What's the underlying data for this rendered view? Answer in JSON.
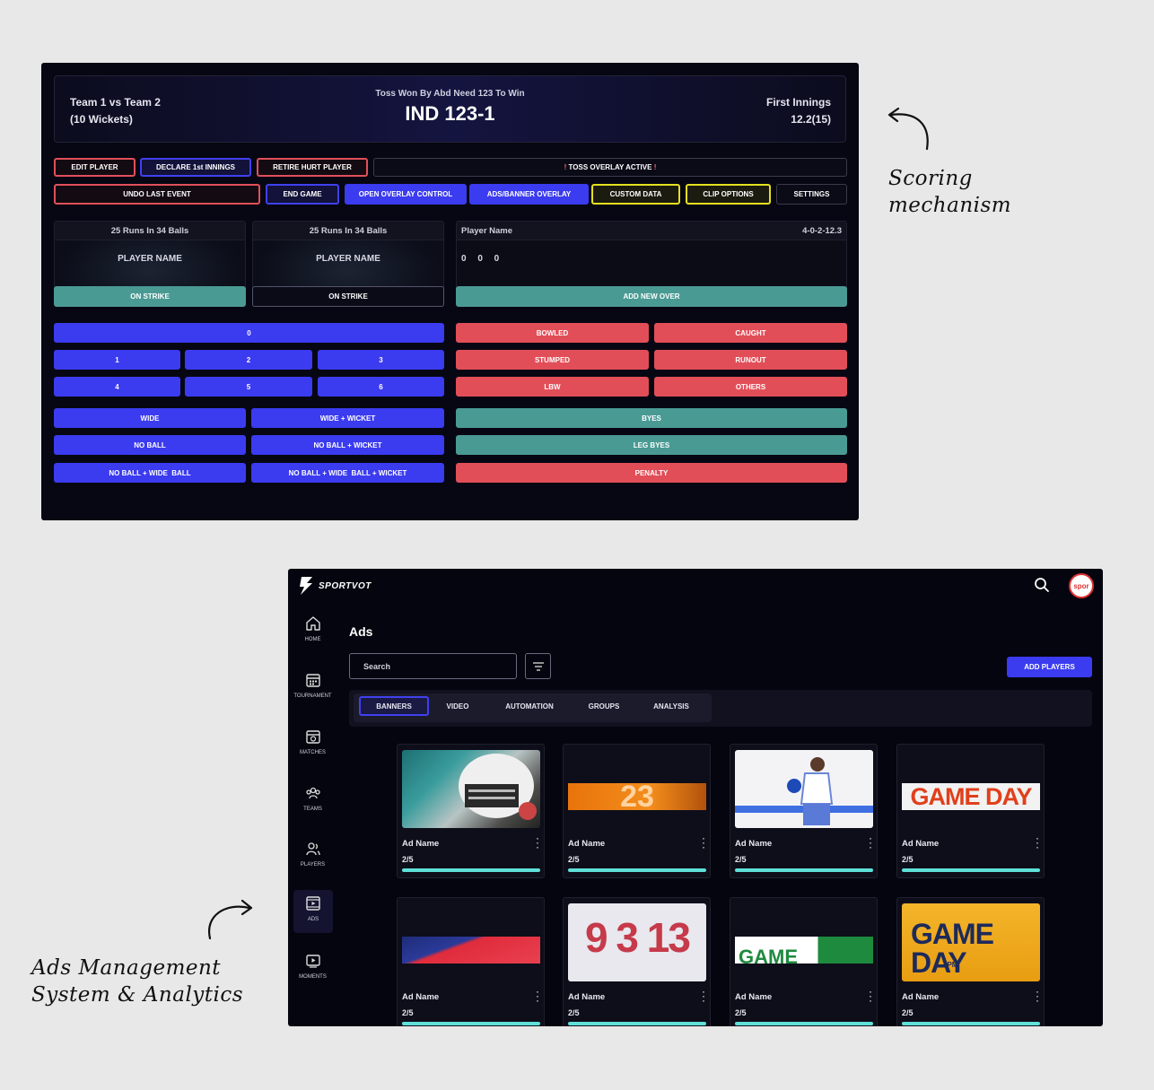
{
  "scoring": {
    "match": "Team 1 vs Team 2",
    "wickets": "(10 Wickets)",
    "toss": "Toss Won By Abd Need 123 To Win",
    "score": "IND 123-1",
    "innings": "First Innings",
    "overs": "12.2(15)",
    "top_buttons": {
      "edit_player": "EDIT PLAYER",
      "declare": "DECLARE 1st INNINGS",
      "retire": "RETIRE HURT PLAYER",
      "toss_mark_l": "!",
      "toss_overlay": "TOSS OVERLAY ACTIVE",
      "toss_mark_r": "!",
      "undo": "UNDO LAST EVENT",
      "end_game": "END GAME",
      "open_overlay": "OPEN OVERLAY CONTROL",
      "ads_overlay": "ADS/BANNER OVERLAY",
      "custom_data": "CUSTOM  DATA",
      "clip_options": "CLIP OPTIONS",
      "settings": "SETTINGS"
    },
    "batter1": {
      "runs": "25 Runs In 34 Balls",
      "name": "PLAYER NAME",
      "strike": "ON STRIKE"
    },
    "batter2": {
      "runs": "25 Runs In 34 Balls",
      "name": "PLAYER NAME",
      "strike": "ON STRIKE"
    },
    "bowler": {
      "name": "Player Name",
      "figures": "4-0-2-12.3",
      "balls": "0 0 0",
      "add_over": "ADD NEW OVER"
    },
    "runs": {
      "r0": "0",
      "r1": "1",
      "r2": "2",
      "r3": "3",
      "r4": "4",
      "r5": "5",
      "r6": "6"
    },
    "dismissals": {
      "bowled": "BOWLED",
      "caught": "CAUGHT",
      "stumped": "STUMPED",
      "runout": "RUNOUT",
      "lbw": "LBW",
      "others": "OTHERS"
    },
    "extras": {
      "wide": "WIDE",
      "wide_wicket": "WIDE + WICKET",
      "no_ball": "NO BALL",
      "no_ball_wicket": "NO BALL + WICKET",
      "nb_wide": "NO BALL + WIDE  BALL",
      "nb_wide_wicket": "NO BALL + WIDE  BALL + WICKET",
      "byes": "BYES",
      "leg_byes": "LEG BYES",
      "penalty": "PENALTY"
    }
  },
  "labels": {
    "scoring_1": "Scoring",
    "scoring_2": "mechanism",
    "ads_1": "Ads Management",
    "ads_2": "System & Analytics"
  },
  "ads": {
    "brand": "SPORTVOT",
    "avatar_text": "spor",
    "nav": [
      "HOME",
      "TOURNAMENT",
      "MATCHES",
      "TEAMS",
      "PLAYERS",
      "ADS",
      "MOMENTS"
    ],
    "title": "Ads",
    "search_placeholder": "Search",
    "add_button": "ADD PLAYERS",
    "tabs": [
      "BANNERS",
      "VIDEO",
      "AUTOMATION",
      "GROUPS",
      "ANALYSIS"
    ],
    "cards": [
      {
        "name": "Ad Name",
        "count": "2/5"
      },
      {
        "name": "Ad Name",
        "count": "2/5",
        "art": "23"
      },
      {
        "name": "Ad Name",
        "count": "2/5"
      },
      {
        "name": "Ad Name",
        "count": "2/5",
        "art": "GAME DAY"
      },
      {
        "name": "Ad Name",
        "count": "2/5"
      },
      {
        "name": "Ad Name",
        "count": "2/5",
        "art": "9 3 13"
      },
      {
        "name": "Ad Name",
        "count": "2/5",
        "art": "GAME"
      },
      {
        "name": "Ad Name",
        "count": "2/5",
        "art": "GAME DAY",
        "art_sub": "4PM"
      }
    ],
    "colors": {
      "accent": "#3b3bf0",
      "progress": "#5fe0d8"
    }
  }
}
